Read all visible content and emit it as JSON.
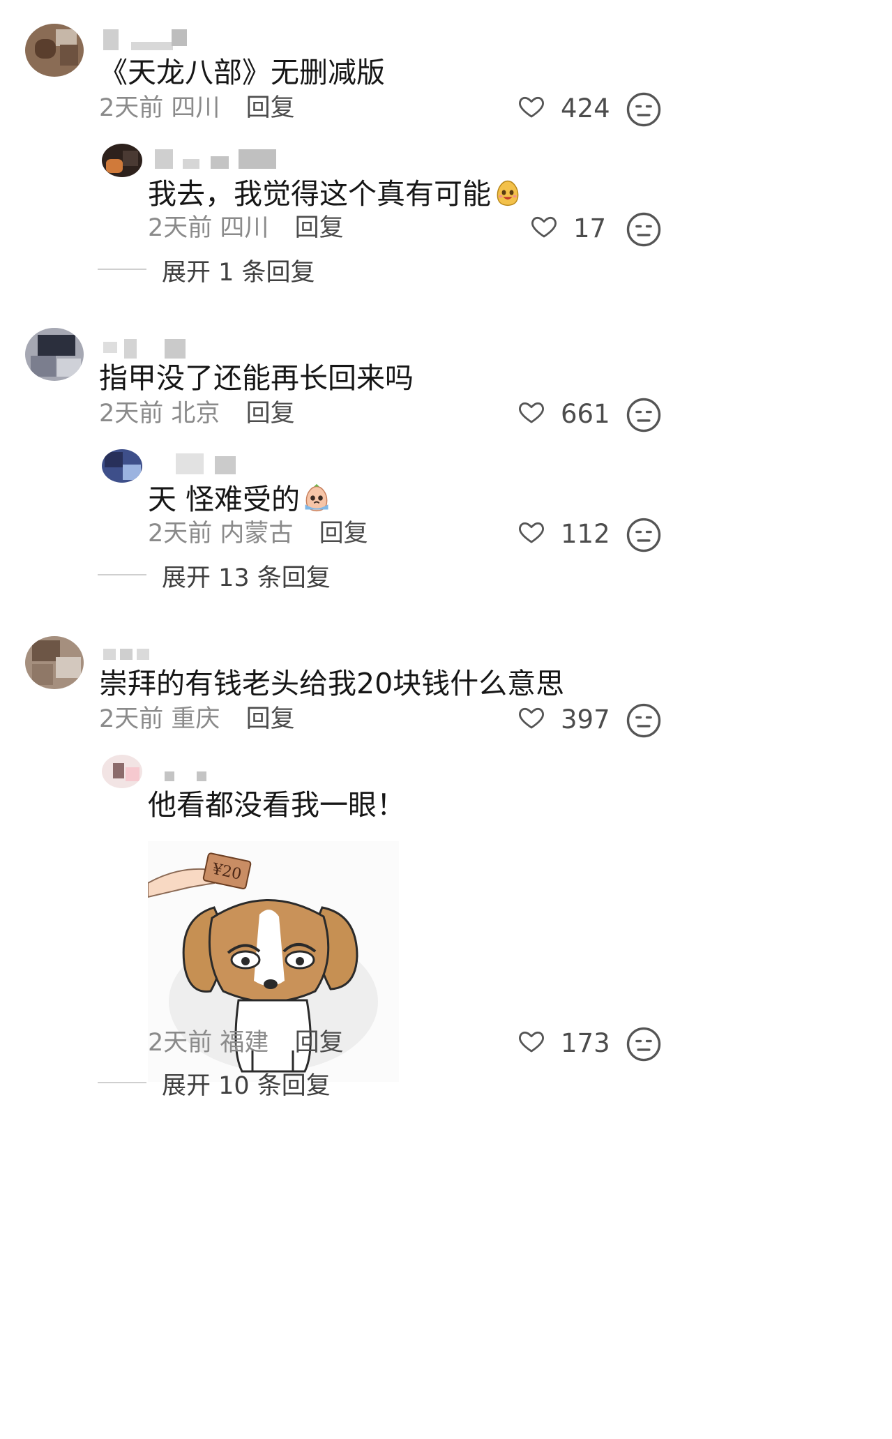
{
  "comments": [
    {
      "text": "《天龙八部》无删减版",
      "time": "2天前",
      "location": "四川",
      "reply_label": "回复",
      "likes": "424",
      "replies": [
        {
          "text": "我去，我觉得这个真有可能",
          "emoji_icon": "laughing-emoji-icon",
          "time": "2天前",
          "location": "四川",
          "reply_label": "回复",
          "likes": "17"
        }
      ],
      "expand_label": "展开 1 条回复"
    },
    {
      "text": "指甲没了还能再长回来吗",
      "time": "2天前",
      "location": "北京",
      "reply_label": "回复",
      "likes": "661",
      "replies": [
        {
          "text": "天 怪难受的",
          "emoji_icon": "crying-emoji-icon",
          "time": "2天前",
          "location": "内蒙古",
          "reply_label": "回复",
          "likes": "112"
        }
      ],
      "expand_label": "展开 13 条回复"
    },
    {
      "text": "崇拜的有钱老头给我20块钱什么意思",
      "time": "2天前",
      "location": "重庆",
      "reply_label": "回复",
      "likes": "397",
      "replies": [
        {
          "text": "他看都没看我一眼！",
          "sticker_icon": "puppy-money-sticker-icon",
          "sticker_text": "¥20",
          "time": "2天前",
          "location": "福建",
          "reply_label": "回复",
          "likes": "173"
        }
      ],
      "expand_label": "展开 10 条回复"
    }
  ],
  "colors": {
    "text": "#161616",
    "meta": "#8a8a8a",
    "reply": "#4c4c4c",
    "icon": "#555555",
    "blur": "#c9c9c9"
  },
  "icons": {
    "like": "heart-outline-icon",
    "dislike": "neutral-face-icon"
  }
}
